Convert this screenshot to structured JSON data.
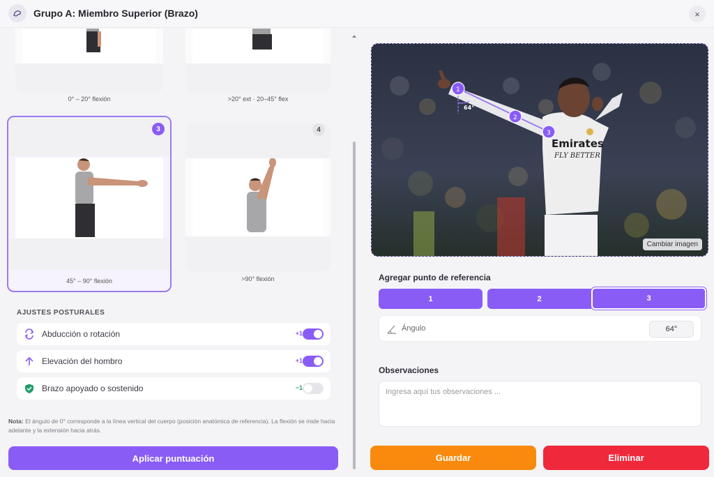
{
  "header": {
    "title": "Grupo A: Miembro Superior (Brazo)",
    "icon": "arm-icon",
    "close_icon": "×"
  },
  "posture_cards": [
    {
      "caption": "0° – 20° flexión",
      "badge": ""
    },
    {
      "caption": ">20° ext · 20–45° flex",
      "badge": ""
    },
    {
      "caption": "45° – 90° flexión",
      "badge": "3",
      "selected": true
    },
    {
      "caption": ">90° flexión",
      "badge": "4"
    }
  ],
  "adjustments": {
    "title": "AJUSTES POSTURALES",
    "items": [
      {
        "label": "Abducción o rotación",
        "points": "+1",
        "on": true,
        "icon": "rotate-icon"
      },
      {
        "label": "Elevación del hombro",
        "points": "+1",
        "on": true,
        "icon": "arrow-up-icon"
      },
      {
        "label": "Brazo apoyado o sostenido",
        "points": "−1",
        "on": false,
        "icon": "shield-check-icon"
      }
    ]
  },
  "note": {
    "label": "Nota:",
    "text": "El ángulo de 0° corresponde a la línea vertical del cuerpo (posición anatómica de referencia). La flexión se mide hacia adelante y la extensión hacia atrás."
  },
  "apply_label": "Aplicar puntuación",
  "photo": {
    "change_label": "Cambiar imagen",
    "angle_marker": "64°",
    "points": [
      "1",
      "2",
      "3"
    ],
    "jersey_text": [
      "Emirates",
      "FLY BETTER"
    ]
  },
  "reference": {
    "title": "Agregar punto de referencia",
    "buttons": [
      "1",
      "2",
      "3"
    ]
  },
  "angle": {
    "label": "Ángulo",
    "value": "64°"
  },
  "observations": {
    "title": "Observaciones",
    "placeholder": "Ingresa aquí tus observaciones ..."
  },
  "actions": {
    "save": "Guardar",
    "delete": "Eliminar"
  },
  "colors": {
    "accent": "#8a5cf6",
    "save": "#f98a0d",
    "delete": "#f0283b",
    "positive": "#8a5cf6",
    "negative": "#1e9c6a"
  }
}
